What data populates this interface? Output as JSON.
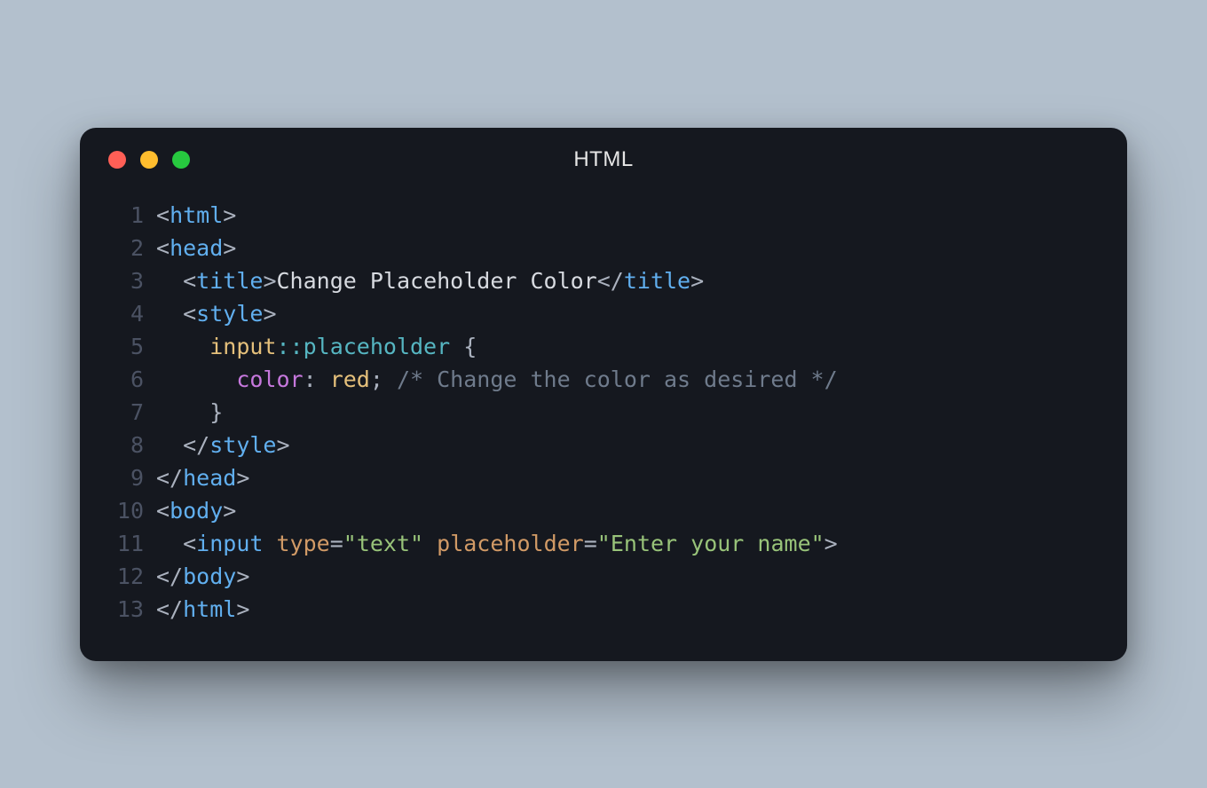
{
  "window": {
    "title": "HTML",
    "traffic": {
      "close": "red",
      "minimize": "yellow",
      "zoom": "green"
    }
  },
  "gutter": {
    "1": "1",
    "2": "2",
    "3": "3",
    "4": "4",
    "5": "5",
    "6": "6",
    "7": "7",
    "8": "8",
    "9": "9",
    "10": "10",
    "11": "11",
    "12": "12",
    "13": "13"
  },
  "code": {
    "l1": {
      "lt": "<",
      "tag": "html",
      "gt": ">"
    },
    "l2": {
      "lt": "<",
      "tag": "head",
      "gt": ">"
    },
    "l3": {
      "indent": "  ",
      "lt1": "<",
      "tag_open": "title",
      "gt1": ">",
      "text": "Change Placeholder Color",
      "lt2": "</",
      "tag_close": "title",
      "gt2": ">"
    },
    "l4": {
      "indent": "  ",
      "lt": "<",
      "tag": "style",
      "gt": ">"
    },
    "l5": {
      "indent": "    ",
      "sel": "input",
      "pseudo": "::placeholder",
      "sp": " ",
      "brace": "{"
    },
    "l6": {
      "indent": "      ",
      "prop": "color",
      "colon": ": ",
      "val": "red",
      "semi": ";",
      "sp": " ",
      "comment": "/* Change the color as desired */"
    },
    "l7": {
      "indent": "    ",
      "brace": "}"
    },
    "l8": {
      "indent": "  ",
      "lt": "</",
      "tag": "style",
      "gt": ">"
    },
    "l9": {
      "lt": "</",
      "tag": "head",
      "gt": ">"
    },
    "l10": {
      "lt": "<",
      "tag": "body",
      "gt": ">"
    },
    "l11": {
      "indent": "  ",
      "lt": "<",
      "tag": "input",
      "sp1": " ",
      "attr1": "type",
      "eq1": "=",
      "val1": "\"text\"",
      "sp2": " ",
      "attr2": "placeholder",
      "eq2": "=",
      "val2": "\"Enter your name\"",
      "gt": ">"
    },
    "l12": {
      "lt": "</",
      "tag": "body",
      "gt": ">"
    },
    "l13": {
      "lt": "</",
      "tag": "html",
      "gt": ">"
    }
  }
}
